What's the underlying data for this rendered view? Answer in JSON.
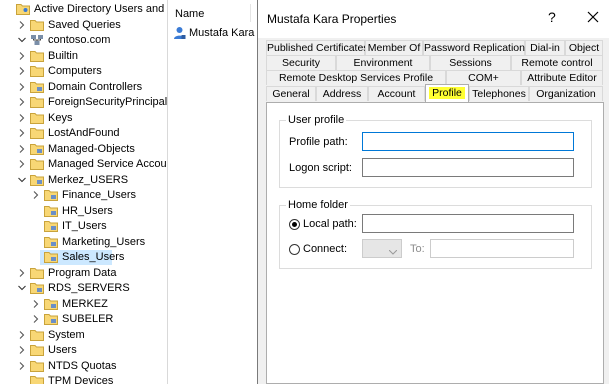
{
  "tree": {
    "items": [
      {
        "label": "Active Directory Users and Com",
        "icon": "ad-console-icon",
        "expander": "none",
        "level": 0
      },
      {
        "label": "Saved Queries",
        "icon": "folder-icon",
        "expander": "collapsed",
        "level": 1
      },
      {
        "label": "contoso.com",
        "icon": "domain-icon",
        "expander": "expanded",
        "level": 1
      },
      {
        "label": "Builtin",
        "icon": "folder-icon",
        "expander": "collapsed",
        "level": 2
      },
      {
        "label": "Computers",
        "icon": "folder-icon",
        "expander": "collapsed",
        "level": 2
      },
      {
        "label": "Domain Controllers",
        "icon": "ou-icon",
        "expander": "collapsed",
        "level": 2
      },
      {
        "label": "ForeignSecurityPrincipals",
        "icon": "folder-icon",
        "expander": "collapsed",
        "level": 2
      },
      {
        "label": "Keys",
        "icon": "folder-icon",
        "expander": "collapsed",
        "level": 2
      },
      {
        "label": "LostAndFound",
        "icon": "folder-icon",
        "expander": "collapsed",
        "level": 2
      },
      {
        "label": "Managed-Objects",
        "icon": "ou-icon",
        "expander": "collapsed",
        "level": 2
      },
      {
        "label": "Managed Service Accour",
        "icon": "folder-icon",
        "expander": "collapsed",
        "level": 2
      },
      {
        "label": "Merkez_USERS",
        "icon": "ou-icon",
        "expander": "expanded",
        "level": 2
      },
      {
        "label": "Finance_Users",
        "icon": "ou-icon",
        "expander": "collapsed",
        "level": 3
      },
      {
        "label": "HR_Users",
        "icon": "ou-icon",
        "expander": "none",
        "level": 3
      },
      {
        "label": "IT_Users",
        "icon": "ou-icon",
        "expander": "none",
        "level": 3
      },
      {
        "label": "Marketing_Users",
        "icon": "ou-icon",
        "expander": "none",
        "level": 3
      },
      {
        "label": "Sales_Users",
        "icon": "ou-icon",
        "expander": "none",
        "level": 3,
        "selected": true
      },
      {
        "label": "Program Data",
        "icon": "folder-icon",
        "expander": "collapsed",
        "level": 2
      },
      {
        "label": "RDS_SERVERS",
        "icon": "ou-icon",
        "expander": "expanded",
        "level": 2
      },
      {
        "label": "MERKEZ",
        "icon": "ou-icon",
        "expander": "collapsed",
        "level": 3
      },
      {
        "label": "SUBELER",
        "icon": "ou-icon",
        "expander": "collapsed",
        "level": 3
      },
      {
        "label": "System",
        "icon": "folder-icon",
        "expander": "collapsed",
        "level": 2
      },
      {
        "label": "Users",
        "icon": "folder-icon",
        "expander": "collapsed",
        "level": 2
      },
      {
        "label": "NTDS Quotas",
        "icon": "folder-icon",
        "expander": "collapsed",
        "level": 2
      },
      {
        "label": "TPM Devices",
        "icon": "folder-icon",
        "expander": "none",
        "level": 2
      }
    ]
  },
  "list": {
    "column_header": "Name",
    "items": [
      {
        "label": "Mustafa Kara",
        "icon": "user-icon"
      }
    ]
  },
  "dialog": {
    "title": "Mustafa Kara Properties",
    "help_label": "?",
    "tabs_row1": [
      "Published Certificates",
      "Member Of",
      "Password Replication",
      "Dial-in",
      "Object"
    ],
    "tabs_row2": [
      "Security",
      "Environment",
      "Sessions",
      "Remote control"
    ],
    "tabs_row3": [
      "Remote Desktop Services Profile",
      "COM+",
      "Attribute Editor"
    ],
    "tabs_row4": [
      "General",
      "Address",
      "Account",
      "Profile",
      "Telephones",
      "Organization"
    ],
    "active_tab": "Profile",
    "highlight_color": "#ffff33",
    "user_profile": {
      "legend": "User profile",
      "profile_path_label": "Profile path:",
      "profile_path_value": "",
      "logon_script_label": "Logon script:",
      "logon_script_value": ""
    },
    "home_folder": {
      "legend": "Home folder",
      "local_path_label": "Local path:",
      "local_path_value": "",
      "local_path_selected": true,
      "connect_label": "Connect:",
      "connect_drive_value": "",
      "to_label": "To:",
      "to_value": ""
    }
  },
  "colors": {
    "selection": "#cce8ff",
    "focus_border": "#0078d7",
    "dialog_background": "#f0f0f0"
  }
}
